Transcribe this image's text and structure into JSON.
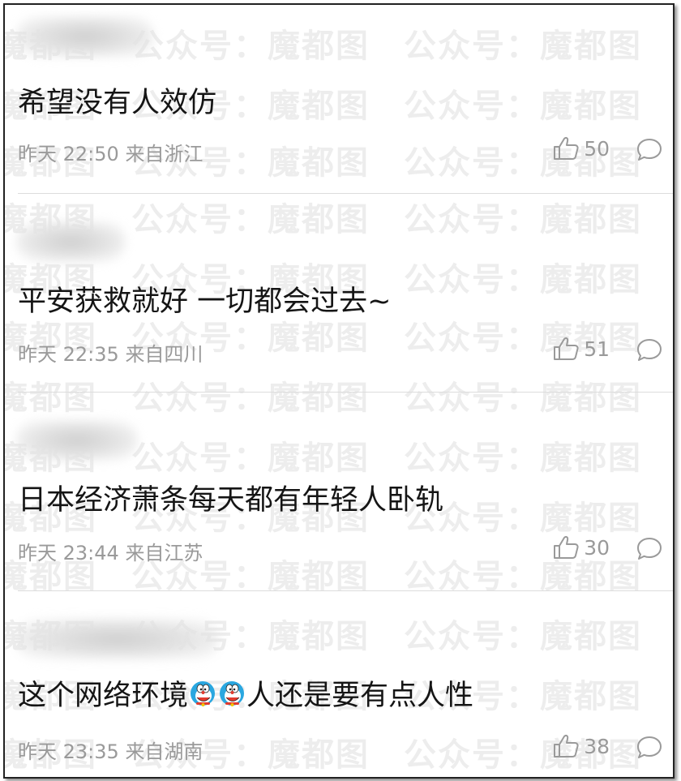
{
  "watermark": {
    "text": "公众号：魔都图"
  },
  "comments": [
    {
      "text": "希望没有人效仿",
      "date": "昨天 22:50",
      "location": "来自浙江",
      "likes": "50"
    },
    {
      "text": "平安获救就好 一切都会过去~",
      "date": "昨天 22:35",
      "location": "来自四川",
      "likes": "51"
    },
    {
      "text": "日本经济萧条每天都有年轻人卧轨",
      "date": "昨天 23:44",
      "location": "来自江苏",
      "likes": "30"
    },
    {
      "text_before": "这个网络环境",
      "text_after": "人还是要有点人性",
      "date": "昨天 23:35",
      "location": "来自湖南",
      "likes": "38"
    }
  ],
  "icons": {
    "like": "thumbs-up-icon",
    "reply": "speech-bubble-icon",
    "emoji": "doraemon-emoji-icon"
  },
  "colors": {
    "text": "#151515",
    "meta": "#9a9a9a",
    "divider": "#dcdcdc"
  }
}
